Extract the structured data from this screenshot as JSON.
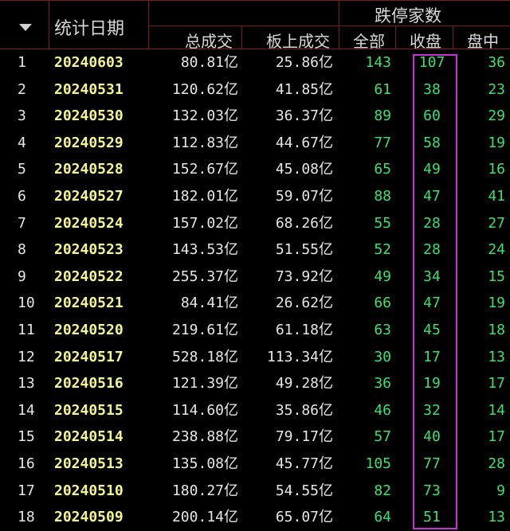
{
  "header": {
    "date_label": "统计日期",
    "group_label": "跌停家数",
    "col_total": "总成交",
    "col_board": "板上成交",
    "col_all": "全部",
    "col_close": "收盘",
    "col_mid": "盘中"
  },
  "unit": "亿",
  "rows": [
    {
      "idx": "1",
      "date": "20240603",
      "total": "80.81",
      "board": "25.86",
      "all": "143",
      "close": "107",
      "mid": "36"
    },
    {
      "idx": "2",
      "date": "20240531",
      "total": "120.62",
      "board": "41.85",
      "all": "61",
      "close": "38",
      "mid": "23"
    },
    {
      "idx": "3",
      "date": "20240530",
      "total": "132.03",
      "board": "36.37",
      "all": "89",
      "close": "60",
      "mid": "29"
    },
    {
      "idx": "4",
      "date": "20240529",
      "total": "112.83",
      "board": "44.67",
      "all": "77",
      "close": "58",
      "mid": "19"
    },
    {
      "idx": "5",
      "date": "20240528",
      "total": "152.67",
      "board": "45.08",
      "all": "65",
      "close": "49",
      "mid": "16"
    },
    {
      "idx": "6",
      "date": "20240527",
      "total": "182.01",
      "board": "59.07",
      "all": "88",
      "close": "47",
      "mid": "41"
    },
    {
      "idx": "7",
      "date": "20240524",
      "total": "157.02",
      "board": "68.26",
      "all": "55",
      "close": "28",
      "mid": "27"
    },
    {
      "idx": "8",
      "date": "20240523",
      "total": "143.53",
      "board": "51.55",
      "all": "52",
      "close": "28",
      "mid": "24"
    },
    {
      "idx": "9",
      "date": "20240522",
      "total": "255.37",
      "board": "73.92",
      "all": "49",
      "close": "34",
      "mid": "15"
    },
    {
      "idx": "10",
      "date": "20240521",
      "total": "84.41",
      "board": "26.62",
      "all": "66",
      "close": "47",
      "mid": "19"
    },
    {
      "idx": "11",
      "date": "20240520",
      "total": "219.61",
      "board": "61.18",
      "all": "63",
      "close": "45",
      "mid": "18"
    },
    {
      "idx": "12",
      "date": "20240517",
      "total": "528.18",
      "board": "113.34",
      "all": "30",
      "close": "17",
      "mid": "13"
    },
    {
      "idx": "13",
      "date": "20240516",
      "total": "121.39",
      "board": "49.28",
      "all": "36",
      "close": "19",
      "mid": "17"
    },
    {
      "idx": "14",
      "date": "20240515",
      "total": "114.60",
      "board": "35.86",
      "all": "46",
      "close": "32",
      "mid": "14"
    },
    {
      "idx": "15",
      "date": "20240514",
      "total": "238.88",
      "board": "79.17",
      "all": "57",
      "close": "40",
      "mid": "17"
    },
    {
      "idx": "16",
      "date": "20240513",
      "total": "135.08",
      "board": "45.77",
      "all": "105",
      "close": "77",
      "mid": "28"
    },
    {
      "idx": "17",
      "date": "20240510",
      "total": "180.27",
      "board": "54.55",
      "all": "82",
      "close": "73",
      "mid": "9"
    },
    {
      "idx": "18",
      "date": "20240509",
      "total": "200.14",
      "board": "65.07",
      "all": "64",
      "close": "51",
      "mid": "13"
    }
  ]
}
